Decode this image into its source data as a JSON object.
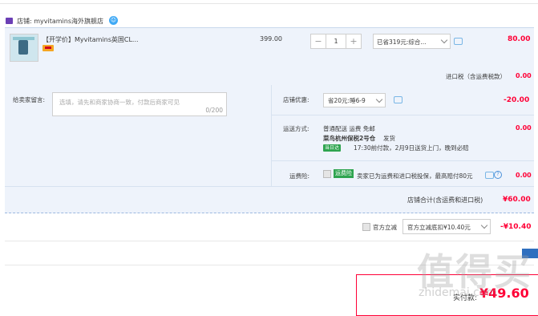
{
  "store": {
    "label": "店铺: myvitamins海外旗舰店"
  },
  "item": {
    "title": "【开学价】Myvitamins英国CL...",
    "unit_price": "399.00",
    "quantity": "1",
    "qty_minus": "−",
    "qty_plus": "+",
    "promo": "已省319元:综合...",
    "subtotal": "80.00",
    "tax_label": "进口税（含运费税款）",
    "tax_value": "0.00"
  },
  "message": {
    "label": "给卖家留言:",
    "placeholder": "选填，请先和商家协商一致，付款后商家可见",
    "counter": "0/200"
  },
  "coupon": {
    "label": "店铺优惠:",
    "selected": "省20元:睡6-9",
    "value": "-20.00"
  },
  "shipping": {
    "label": "运送方式:",
    "method": "普通配送 运费 免邮",
    "warehouse": "菜鸟杭州保税2号仓",
    "ship_word": "发货",
    "today_badge": "当日达",
    "note": "17:30前付款，2月9日送货上门，晚到必赔",
    "value": "0.00"
  },
  "insurance": {
    "label": "运费险:",
    "badge": "运费险",
    "text": "卖家已为运费和进口税投保，最高赔付80元",
    "value": "0.00"
  },
  "store_total": {
    "label": "店铺合计(含运费和进口税)",
    "value": "¥60.00"
  },
  "official": {
    "label": "官方立减",
    "selected": "官方立减底扣¥10.40元",
    "value": "-¥10.40"
  },
  "checkout": {
    "label": "实付款:",
    "value": "¥49.60"
  },
  "watermark": {
    "big": "值得买",
    "small": "zhidemai.com"
  }
}
